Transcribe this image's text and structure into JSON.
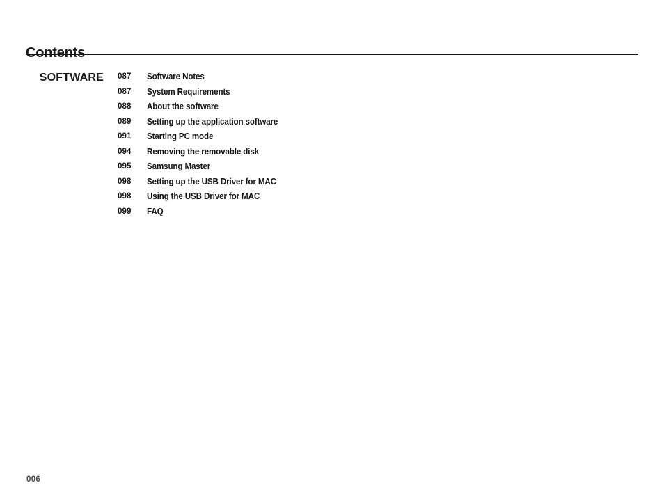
{
  "document": {
    "title": "Contents",
    "folio": "006",
    "rule_color": "#141414",
    "text_color": "#161616",
    "folio_color": "#4a4a4a"
  },
  "contents": {
    "sections": [
      {
        "label": "SOFTWARE",
        "entries": [
          {
            "page": "087",
            "title": "Software Notes"
          },
          {
            "page": "087",
            "title": "System Requirements"
          },
          {
            "page": "088",
            "title": "About the software"
          },
          {
            "page": "089",
            "title": "Setting up the application software"
          },
          {
            "page": "091",
            "title": "Starting PC mode"
          },
          {
            "page": "094",
            "title": "Removing the removable disk"
          },
          {
            "page": "095",
            "title": "Samsung Master"
          },
          {
            "page": "098",
            "title": "Setting up the USB Driver for MAC"
          },
          {
            "page": "098",
            "title": "Using the USB Driver for MAC"
          },
          {
            "page": "099",
            "title": "FAQ"
          }
        ]
      }
    ]
  }
}
